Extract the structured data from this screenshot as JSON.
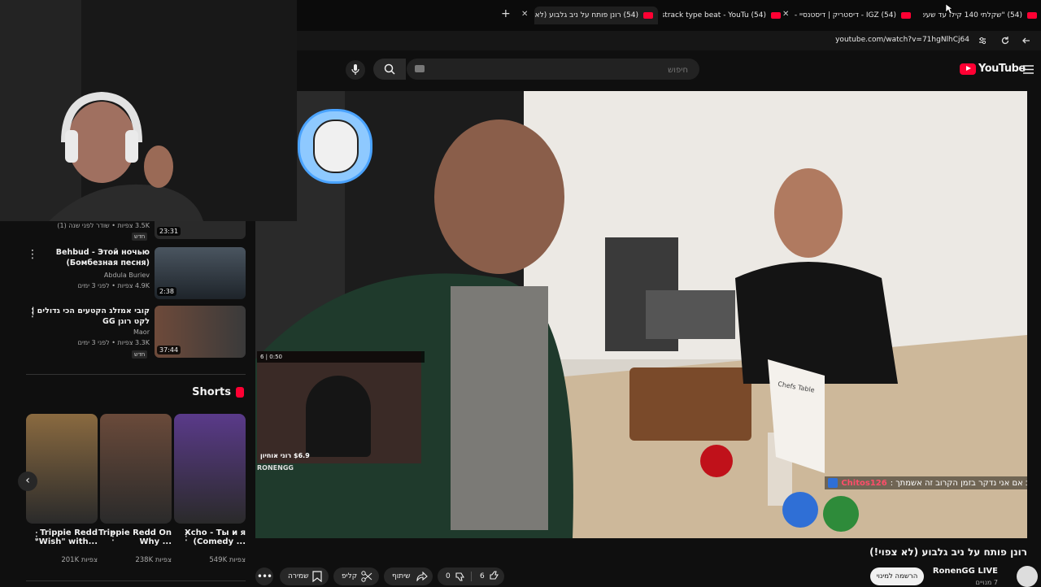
{
  "browser": {
    "tabs": [
      {
        "title": "(54) \"שקלתי 140 קילו עד שעשי"
      },
      {
        "title": "(54) IGZ - דיסטריק | דיסטנסיי - Y"
      },
      {
        "title": "(54) disstrack type beat - YouTu"
      },
      {
        "title": "(54) רונן פותח על ניב גלבוע (לא"
      }
    ],
    "new_tab": "+",
    "url": "youtube.com/watch?v=71hgNlhCj64"
  },
  "youtube": {
    "logo": "YouTube",
    "search_placeholder": "חיפוש"
  },
  "video": {
    "streamer_name": "RONENGG",
    "overlay_stats": "6 | 0:50",
    "donation": "$6.9 רוני אוחיון",
    "chat_user": "Chitos126",
    "chat_message": "טוב אם אני נדקר בזמן הקרוב זה אשמתך :",
    "sign_text": "Chefs Table"
  },
  "sidebar": {
    "top_partial_meta": "3.5K צפיות • שודר לפני שנה (1)",
    "top_partial_badge": "חדש",
    "top_partial_duration": "23:31",
    "related": [
      {
        "title": "Behbud - Этой ночью (Бомбезная песня)",
        "channel": "Abdula Buriev",
        "meta": "4.9K צפיות • לפני 3 ימים",
        "duration": "2:38"
      },
      {
        "title": "קובי אמזלג הקטעים הכי גדולים | לקט רונן GG",
        "channel": "Maor",
        "meta": "3.3K צפיות • לפני 3 ימים",
        "badge": "חדש",
        "duration": "37:44"
      }
    ],
    "shorts_heading": "Shorts",
    "shorts": [
      {
        "title": "Trippie Redd \"Wish\" with...",
        "views": "201K צפיות"
      },
      {
        "title": "Trippie Redd On Why ...",
        "views": "238K צפיות"
      },
      {
        "title": "Xcho - Ты и я (Comedy ...",
        "views": "549K צפיות"
      }
    ]
  },
  "below_video": {
    "title": "רונן פותח על ניב גלבוע (לא צפוי!)",
    "channel": "RonenGG LIVE",
    "subscribers": "7 מנויים",
    "subscribe_label": "הרשמה למינוי",
    "likes": "6",
    "dislikes": "0",
    "share_label": "שיתוף",
    "clip_label": "קליפ",
    "save_label": "שמירה"
  },
  "colors": {
    "yt_red": "#ff0033",
    "bg": "#0f0f0f",
    "chat_user": "#ff4d6a"
  }
}
